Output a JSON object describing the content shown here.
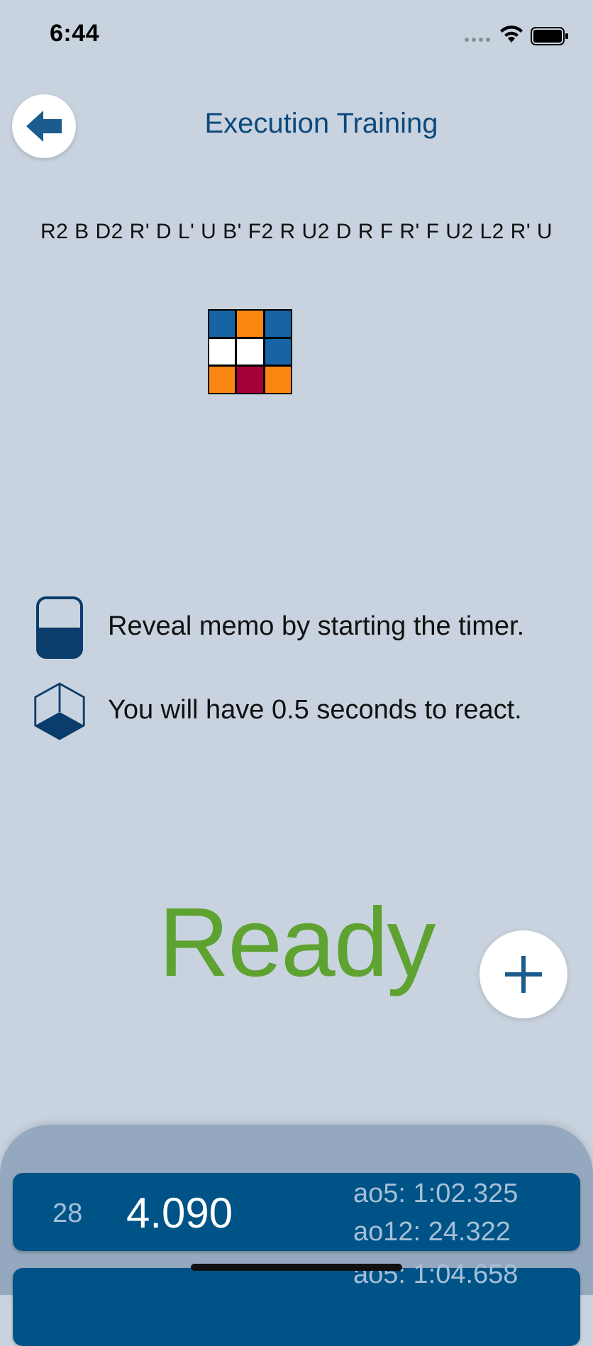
{
  "status_bar": {
    "time": "6:44",
    "icons": [
      "signal-icon",
      "wifi-icon",
      "battery-icon"
    ]
  },
  "header": {
    "back_icon": "arrow-left-icon",
    "title": "Execution Training"
  },
  "scramble": "R2 B D2 R' D L' U B' F2 R U2 D R F R' F U2 L2 R' U",
  "cube_face": {
    "stickers": [
      "#1863a5",
      "#f98610",
      "#1863a5",
      "#ffffff",
      "#ffffff",
      "#1863a5",
      "#f98610",
      "#a30036",
      "#f98610"
    ]
  },
  "instructions": [
    {
      "icon": "half-filled-square-icon",
      "text": "Reveal memo by starting the timer."
    },
    {
      "icon": "cube-outline-icon",
      "text": "You will have 0.5 seconds to react."
    }
  ],
  "timer": {
    "state": "Ready",
    "color": "#5ea331"
  },
  "add_button": {
    "icon": "plus-icon"
  },
  "results": [
    {
      "index": "28",
      "time": "4.090",
      "ao5": "ao5: 1:02.325",
      "ao12": "ao12: 24.322"
    },
    {
      "index": "",
      "time": "",
      "ao5": "ao5: 1:04.658",
      "ao12": ""
    }
  ],
  "colors": {
    "background": "#c8d3df",
    "accent": "#0c4a7c",
    "card": "#005387",
    "panel": "#94a8bf"
  }
}
